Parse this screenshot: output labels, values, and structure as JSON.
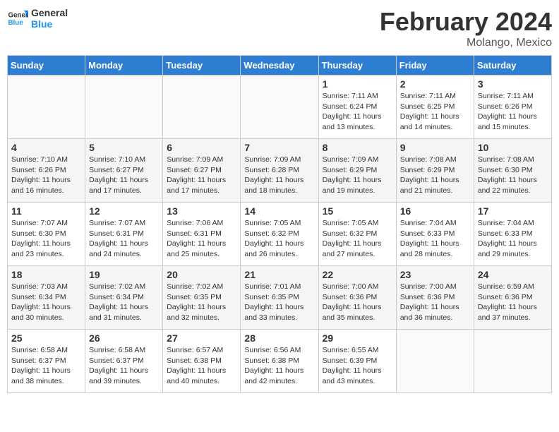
{
  "header": {
    "logo_line1": "General",
    "logo_line2": "Blue",
    "title": "February 2024",
    "subtitle": "Molango, Mexico"
  },
  "weekdays": [
    "Sunday",
    "Monday",
    "Tuesday",
    "Wednesday",
    "Thursday",
    "Friday",
    "Saturday"
  ],
  "weeks": [
    [
      {
        "day": "",
        "info": ""
      },
      {
        "day": "",
        "info": ""
      },
      {
        "day": "",
        "info": ""
      },
      {
        "day": "",
        "info": ""
      },
      {
        "day": "1",
        "info": "Sunrise: 7:11 AM\nSunset: 6:24 PM\nDaylight: 11 hours\nand 13 minutes."
      },
      {
        "day": "2",
        "info": "Sunrise: 7:11 AM\nSunset: 6:25 PM\nDaylight: 11 hours\nand 14 minutes."
      },
      {
        "day": "3",
        "info": "Sunrise: 7:11 AM\nSunset: 6:26 PM\nDaylight: 11 hours\nand 15 minutes."
      }
    ],
    [
      {
        "day": "4",
        "info": "Sunrise: 7:10 AM\nSunset: 6:26 PM\nDaylight: 11 hours\nand 16 minutes."
      },
      {
        "day": "5",
        "info": "Sunrise: 7:10 AM\nSunset: 6:27 PM\nDaylight: 11 hours\nand 17 minutes."
      },
      {
        "day": "6",
        "info": "Sunrise: 7:09 AM\nSunset: 6:27 PM\nDaylight: 11 hours\nand 17 minutes."
      },
      {
        "day": "7",
        "info": "Sunrise: 7:09 AM\nSunset: 6:28 PM\nDaylight: 11 hours\nand 18 minutes."
      },
      {
        "day": "8",
        "info": "Sunrise: 7:09 AM\nSunset: 6:29 PM\nDaylight: 11 hours\nand 19 minutes."
      },
      {
        "day": "9",
        "info": "Sunrise: 7:08 AM\nSunset: 6:29 PM\nDaylight: 11 hours\nand 21 minutes."
      },
      {
        "day": "10",
        "info": "Sunrise: 7:08 AM\nSunset: 6:30 PM\nDaylight: 11 hours\nand 22 minutes."
      }
    ],
    [
      {
        "day": "11",
        "info": "Sunrise: 7:07 AM\nSunset: 6:30 PM\nDaylight: 11 hours\nand 23 minutes."
      },
      {
        "day": "12",
        "info": "Sunrise: 7:07 AM\nSunset: 6:31 PM\nDaylight: 11 hours\nand 24 minutes."
      },
      {
        "day": "13",
        "info": "Sunrise: 7:06 AM\nSunset: 6:31 PM\nDaylight: 11 hours\nand 25 minutes."
      },
      {
        "day": "14",
        "info": "Sunrise: 7:05 AM\nSunset: 6:32 PM\nDaylight: 11 hours\nand 26 minutes."
      },
      {
        "day": "15",
        "info": "Sunrise: 7:05 AM\nSunset: 6:32 PM\nDaylight: 11 hours\nand 27 minutes."
      },
      {
        "day": "16",
        "info": "Sunrise: 7:04 AM\nSunset: 6:33 PM\nDaylight: 11 hours\nand 28 minutes."
      },
      {
        "day": "17",
        "info": "Sunrise: 7:04 AM\nSunset: 6:33 PM\nDaylight: 11 hours\nand 29 minutes."
      }
    ],
    [
      {
        "day": "18",
        "info": "Sunrise: 7:03 AM\nSunset: 6:34 PM\nDaylight: 11 hours\nand 30 minutes."
      },
      {
        "day": "19",
        "info": "Sunrise: 7:02 AM\nSunset: 6:34 PM\nDaylight: 11 hours\nand 31 minutes."
      },
      {
        "day": "20",
        "info": "Sunrise: 7:02 AM\nSunset: 6:35 PM\nDaylight: 11 hours\nand 32 minutes."
      },
      {
        "day": "21",
        "info": "Sunrise: 7:01 AM\nSunset: 6:35 PM\nDaylight: 11 hours\nand 33 minutes."
      },
      {
        "day": "22",
        "info": "Sunrise: 7:00 AM\nSunset: 6:36 PM\nDaylight: 11 hours\nand 35 minutes."
      },
      {
        "day": "23",
        "info": "Sunrise: 7:00 AM\nSunset: 6:36 PM\nDaylight: 11 hours\nand 36 minutes."
      },
      {
        "day": "24",
        "info": "Sunrise: 6:59 AM\nSunset: 6:36 PM\nDaylight: 11 hours\nand 37 minutes."
      }
    ],
    [
      {
        "day": "25",
        "info": "Sunrise: 6:58 AM\nSunset: 6:37 PM\nDaylight: 11 hours\nand 38 minutes."
      },
      {
        "day": "26",
        "info": "Sunrise: 6:58 AM\nSunset: 6:37 PM\nDaylight: 11 hours\nand 39 minutes."
      },
      {
        "day": "27",
        "info": "Sunrise: 6:57 AM\nSunset: 6:38 PM\nDaylight: 11 hours\nand 40 minutes."
      },
      {
        "day": "28",
        "info": "Sunrise: 6:56 AM\nSunset: 6:38 PM\nDaylight: 11 hours\nand 42 minutes."
      },
      {
        "day": "29",
        "info": "Sunrise: 6:55 AM\nSunset: 6:39 PM\nDaylight: 11 hours\nand 43 minutes."
      },
      {
        "day": "",
        "info": ""
      },
      {
        "day": "",
        "info": ""
      }
    ]
  ]
}
